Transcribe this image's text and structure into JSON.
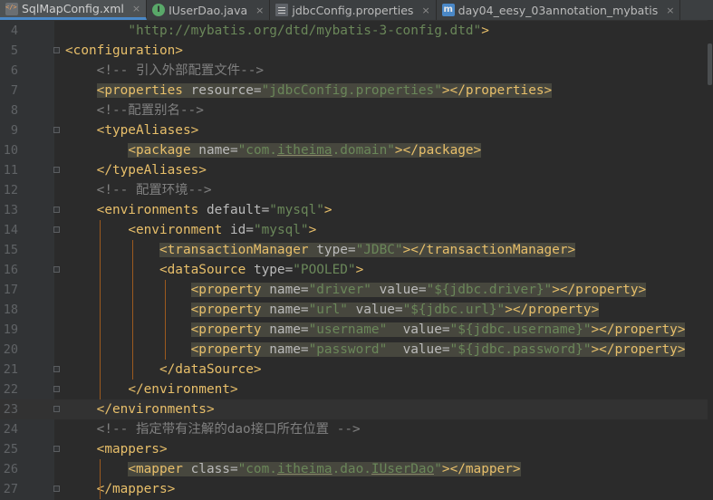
{
  "tabs": [
    {
      "label": "SqlMapConfig.xml",
      "icon": "xml-file-icon",
      "active": true
    },
    {
      "label": "IUserDao.java",
      "icon": "interface-icon",
      "active": false
    },
    {
      "label": "jdbcConfig.properties",
      "icon": "properties-file-icon",
      "active": false
    },
    {
      "label": "day04_eesy_03annotation_mybatis",
      "icon": "module-icon",
      "active": false
    }
  ],
  "close_glyph": "×",
  "current_line": 23,
  "lines": [
    {
      "n": 4,
      "segs": [
        {
          "t": "        "
        },
        {
          "c": "url",
          "t": "\"http://mybatis.org/dtd/mybatis-3-config.dtd\""
        },
        {
          "c": "tag",
          "t": ">"
        }
      ]
    },
    {
      "n": 5,
      "segs": [
        {
          "c": "tag",
          "t": "<configuration>"
        }
      ]
    },
    {
      "n": 6,
      "segs": [
        {
          "t": "    "
        },
        {
          "c": "cm",
          "t": "<!-- 引入外部配置文件-->"
        }
      ]
    },
    {
      "n": 7,
      "segs": [
        {
          "t": "    "
        },
        {
          "c": "tag hl",
          "t": "<properties "
        },
        {
          "c": "attr hl",
          "t": "resource="
        },
        {
          "c": "val hl",
          "t": "\"jdbcConfig.properties\""
        },
        {
          "c": "tag hl",
          "t": "></properties>"
        }
      ]
    },
    {
      "n": 8,
      "segs": [
        {
          "t": "    "
        },
        {
          "c": "cm",
          "t": "<!--配置别名-->"
        }
      ]
    },
    {
      "n": 9,
      "segs": [
        {
          "t": "    "
        },
        {
          "c": "tag",
          "t": "<typeAliases>"
        }
      ]
    },
    {
      "n": 10,
      "segs": [
        {
          "t": "        "
        },
        {
          "c": "tag hl",
          "t": "<package "
        },
        {
          "c": "attr hl",
          "t": "name="
        },
        {
          "c": "val hl",
          "t": "\"com."
        },
        {
          "c": "val hl u",
          "t": "itheima"
        },
        {
          "c": "val hl",
          "t": ".domain\""
        },
        {
          "c": "tag hl",
          "t": "></package>"
        }
      ]
    },
    {
      "n": 11,
      "segs": [
        {
          "t": "    "
        },
        {
          "c": "tag",
          "t": "</typeAliases>"
        }
      ]
    },
    {
      "n": 12,
      "segs": [
        {
          "t": "    "
        },
        {
          "c": "cm",
          "t": "<!-- 配置环境-->"
        }
      ]
    },
    {
      "n": 13,
      "segs": [
        {
          "t": "    "
        },
        {
          "c": "tag",
          "t": "<environments "
        },
        {
          "c": "attr",
          "t": "default="
        },
        {
          "c": "val",
          "t": "\"mysql\""
        },
        {
          "c": "tag",
          "t": ">"
        }
      ]
    },
    {
      "n": 14,
      "segs": [
        {
          "t": "        "
        },
        {
          "c": "tag",
          "t": "<environment "
        },
        {
          "c": "attr",
          "t": "id="
        },
        {
          "c": "val",
          "t": "\"mysql\""
        },
        {
          "c": "tag",
          "t": ">"
        }
      ]
    },
    {
      "n": 15,
      "segs": [
        {
          "t": "            "
        },
        {
          "c": "tag hl",
          "t": "<transactionManager "
        },
        {
          "c": "attr hl",
          "t": "type="
        },
        {
          "c": "val hl",
          "t": "\"JDBC\""
        },
        {
          "c": "tag hl",
          "t": "></transactionManager>"
        }
      ]
    },
    {
      "n": 16,
      "segs": [
        {
          "t": "            "
        },
        {
          "c": "tag",
          "t": "<dataSource "
        },
        {
          "c": "attr",
          "t": "type="
        },
        {
          "c": "val",
          "t": "\"POOLED\""
        },
        {
          "c": "tag",
          "t": ">"
        }
      ]
    },
    {
      "n": 17,
      "segs": [
        {
          "t": "                "
        },
        {
          "c": "tag hl",
          "t": "<property "
        },
        {
          "c": "attr hl",
          "t": "name="
        },
        {
          "c": "val hl",
          "t": "\"driver\" "
        },
        {
          "c": "attr hl",
          "t": "value="
        },
        {
          "c": "val hl",
          "t": "\"${jdbc.driver}\""
        },
        {
          "c": "tag hl",
          "t": "></property>"
        }
      ]
    },
    {
      "n": 18,
      "segs": [
        {
          "t": "                "
        },
        {
          "c": "tag hl",
          "t": "<property "
        },
        {
          "c": "attr hl",
          "t": "name="
        },
        {
          "c": "val hl",
          "t": "\"url\" "
        },
        {
          "c": "attr hl",
          "t": "value="
        },
        {
          "c": "val hl",
          "t": "\"${jdbc.url}\""
        },
        {
          "c": "tag hl",
          "t": "></property>"
        }
      ]
    },
    {
      "n": 19,
      "segs": [
        {
          "t": "                "
        },
        {
          "c": "tag hl",
          "t": "<property "
        },
        {
          "c": "attr hl",
          "t": "name="
        },
        {
          "c": "val hl",
          "t": "\"username\"  "
        },
        {
          "c": "attr hl",
          "t": "value="
        },
        {
          "c": "val hl",
          "t": "\"${jdbc.username}\""
        },
        {
          "c": "tag hl",
          "t": "></property>"
        }
      ]
    },
    {
      "n": 20,
      "segs": [
        {
          "t": "                "
        },
        {
          "c": "tag hl",
          "t": "<property "
        },
        {
          "c": "attr hl",
          "t": "name="
        },
        {
          "c": "val hl",
          "t": "\"password\"  "
        },
        {
          "c": "attr hl",
          "t": "value="
        },
        {
          "c": "val hl",
          "t": "\"${jdbc.password}\""
        },
        {
          "c": "tag hl",
          "t": "></property>"
        }
      ]
    },
    {
      "n": 21,
      "segs": [
        {
          "t": "            "
        },
        {
          "c": "tag",
          "t": "</dataSource>"
        }
      ]
    },
    {
      "n": 22,
      "segs": [
        {
          "t": "        "
        },
        {
          "c": "tag",
          "t": "</environment>"
        }
      ]
    },
    {
      "n": 23,
      "segs": [
        {
          "t": "    "
        },
        {
          "c": "tag",
          "t": "</environments>"
        }
      ]
    },
    {
      "n": 24,
      "segs": [
        {
          "t": "    "
        },
        {
          "c": "cm",
          "t": "<!-- 指定带有注解的dao接口所在位置 -->"
        }
      ]
    },
    {
      "n": 25,
      "segs": [
        {
          "t": "    "
        },
        {
          "c": "tag",
          "t": "<mappers>"
        }
      ]
    },
    {
      "n": 26,
      "segs": [
        {
          "t": "        "
        },
        {
          "c": "tag hl",
          "t": "<mapper "
        },
        {
          "c": "attr hl",
          "t": "class="
        },
        {
          "c": "val hl",
          "t": "\"com."
        },
        {
          "c": "val hl u",
          "t": "itheima"
        },
        {
          "c": "val hl",
          "t": ".dao."
        },
        {
          "c": "val hl u",
          "t": "IUserDao"
        },
        {
          "c": "val hl",
          "t": "\""
        },
        {
          "c": "tag hl",
          "t": "></mapper>"
        }
      ]
    },
    {
      "n": 27,
      "segs": [
        {
          "t": "    "
        },
        {
          "c": "tag",
          "t": "</mappers>"
        }
      ]
    }
  ],
  "colors": {
    "background": "#2b2b2b",
    "tag": "#e8bf6a",
    "attribute": "#bababa",
    "string": "#6a8759",
    "comment": "#808080",
    "highlight": "#47473e",
    "indent_guide": "#9c5a1e"
  }
}
